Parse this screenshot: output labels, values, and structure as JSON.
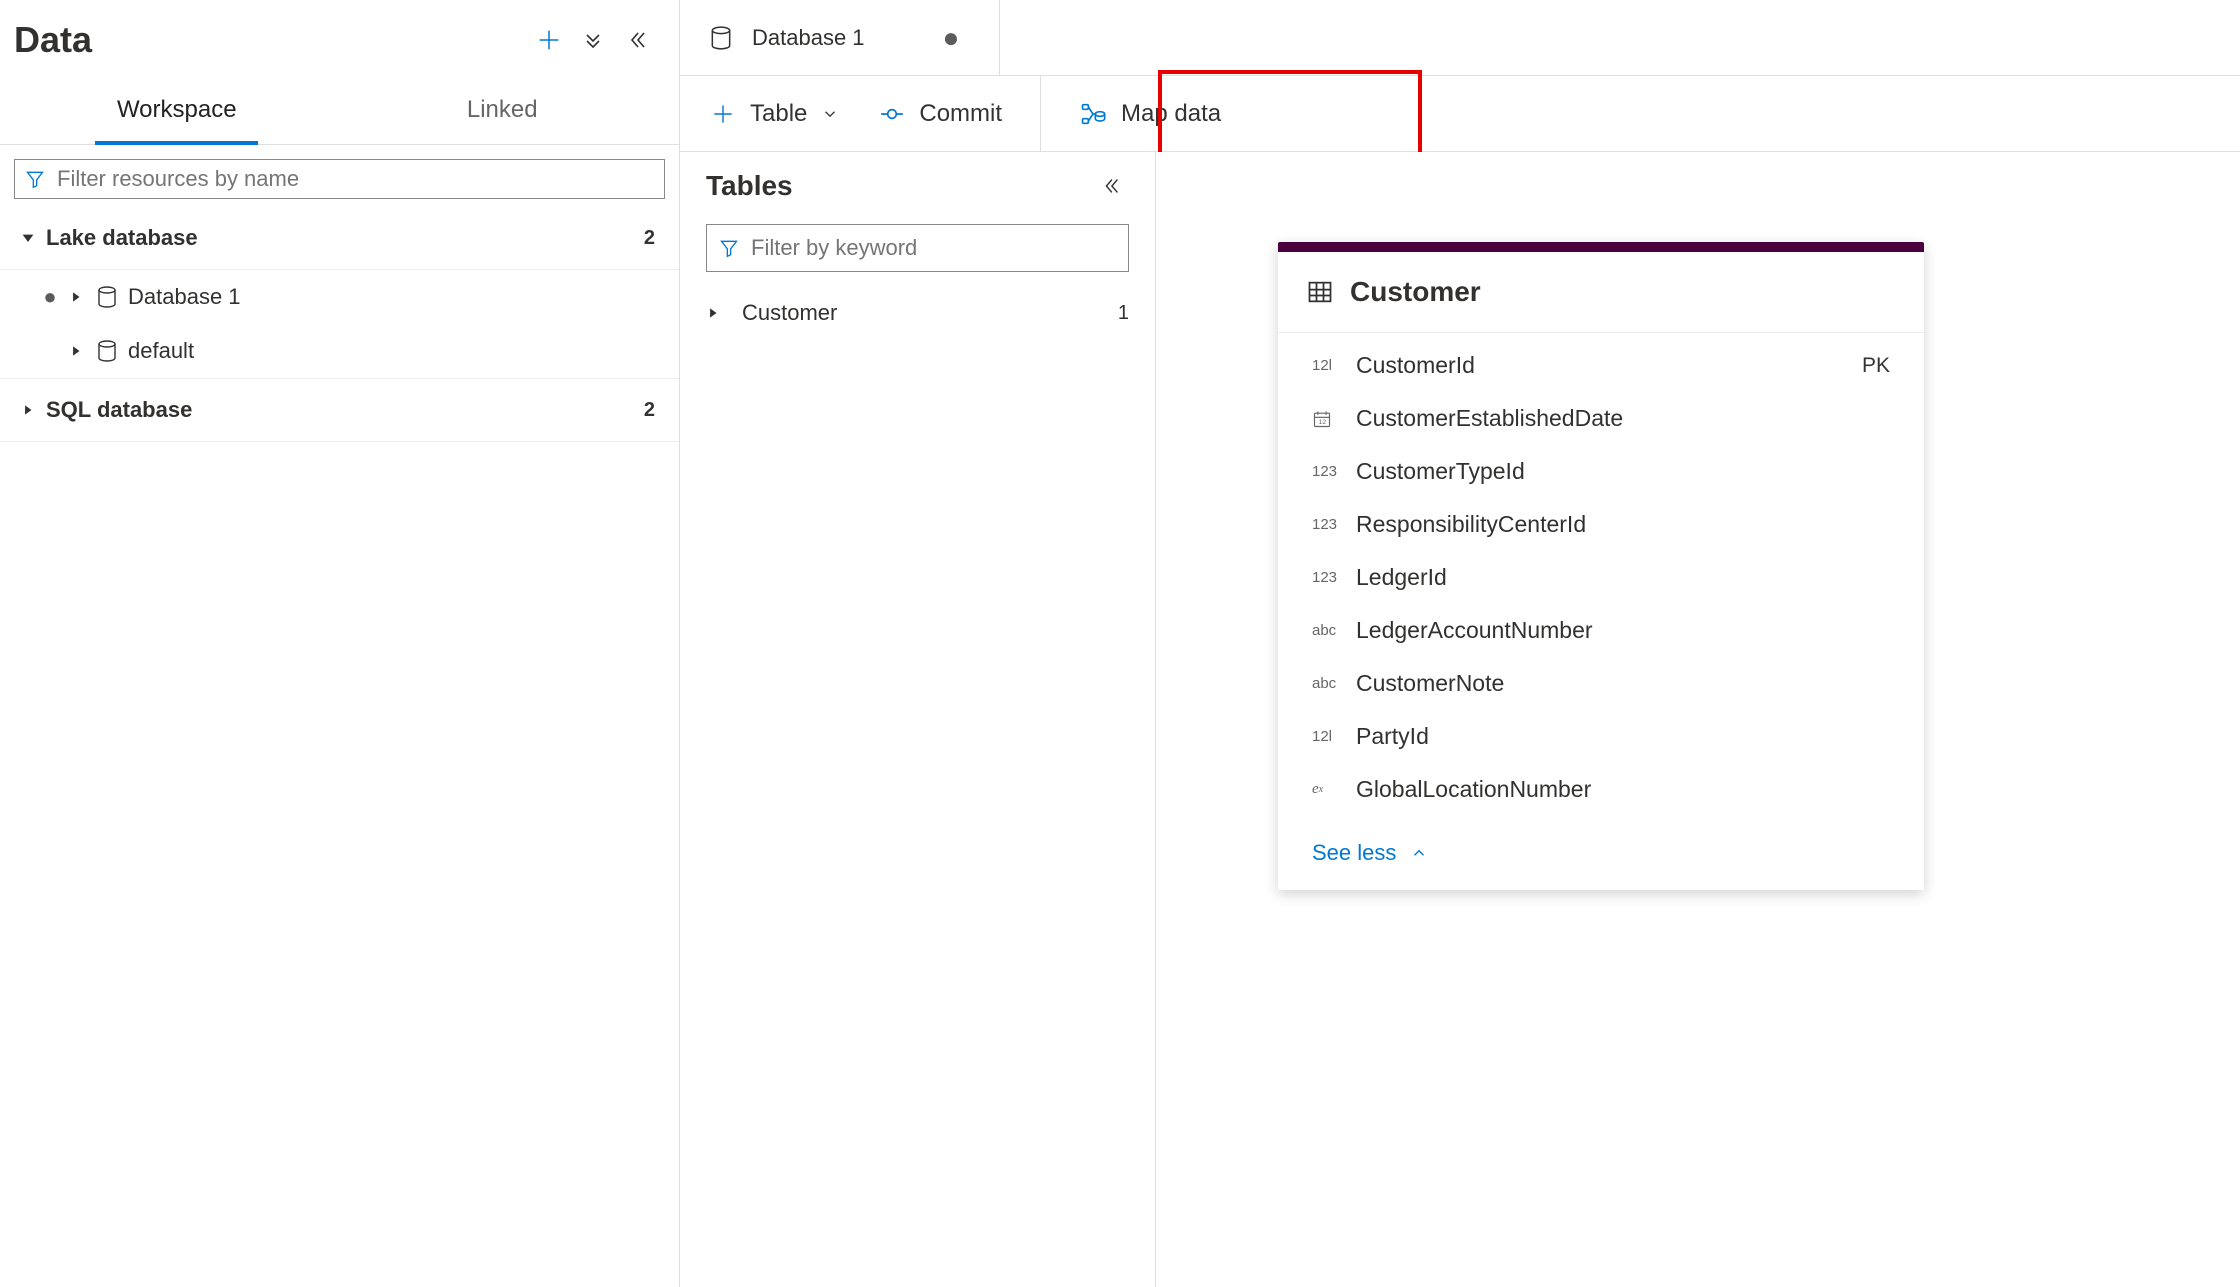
{
  "sidebar": {
    "title": "Data",
    "tabs": {
      "workspace": "Workspace",
      "linked": "Linked"
    },
    "filter_placeholder": "Filter resources by name",
    "tree": {
      "lake_label": "Lake database",
      "lake_count": "2",
      "items": [
        {
          "label": "Database 1"
        },
        {
          "label": "default"
        }
      ],
      "sql_label": "SQL database",
      "sql_count": "2"
    }
  },
  "doc_tab": {
    "title": "Database 1"
  },
  "cmdbar": {
    "table": "Table",
    "commit": "Commit",
    "mapdata": "Map data"
  },
  "tables_panel": {
    "title": "Tables",
    "filter_placeholder": "Filter by keyword",
    "rows": [
      {
        "label": "Customer",
        "count": "1"
      }
    ]
  },
  "entity": {
    "name": "Customer",
    "columns": [
      {
        "type": "12l",
        "name": "CustomerId",
        "key": "PK"
      },
      {
        "type": "date",
        "name": "CustomerEstablishedDate",
        "key": ""
      },
      {
        "type": "123",
        "name": "CustomerTypeId",
        "key": ""
      },
      {
        "type": "123",
        "name": "ResponsibilityCenterId",
        "key": ""
      },
      {
        "type": "123",
        "name": "LedgerId",
        "key": ""
      },
      {
        "type": "abc",
        "name": "LedgerAccountNumber",
        "key": ""
      },
      {
        "type": "abc",
        "name": "CustomerNote",
        "key": ""
      },
      {
        "type": "12l",
        "name": "PartyId",
        "key": ""
      },
      {
        "type": "ex",
        "name": "GlobalLocationNumber",
        "key": ""
      }
    ],
    "see_less": "See less"
  }
}
